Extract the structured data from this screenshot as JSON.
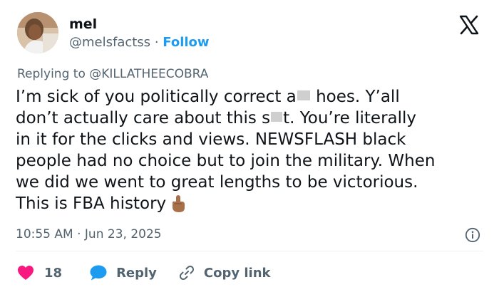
{
  "author": {
    "name": "mel",
    "handle": "@melsfactss",
    "separator": "·",
    "follow_label": "Follow"
  },
  "reply_to": {
    "prefix": "Replying to",
    "handle": "@KILLATHEECOBRA"
  },
  "tweet": {
    "line1_a": "I’m sick of you politically correct a",
    "line1_b": " hoes. Y’all",
    "line2_a": "don’t actually care about this s",
    "line2_b": "t. You’re literally",
    "line3": "in it for the clicks and views. NEWSFLASH black",
    "line4": "people had no choice but to join the military. When",
    "line5": "we did we went to great lengths to be victorious.",
    "line6": "This is FBA history"
  },
  "timestamp": {
    "time": "10:55 AM",
    "separator": "·",
    "date": "Jun 23, 2025"
  },
  "actions": {
    "like_count": "18",
    "reply_label": "Reply",
    "copy_link_label": "Copy link"
  },
  "colors": {
    "like": "#f91880",
    "reply": "#1d9bf0",
    "link": "#1d9bf0",
    "secondary_text": "#536471",
    "text": "#0f1419"
  },
  "icons": [
    "x-logo-icon",
    "heart-icon",
    "reply-bubble-icon",
    "link-icon",
    "info-icon",
    "middle-finger-emoji"
  ]
}
